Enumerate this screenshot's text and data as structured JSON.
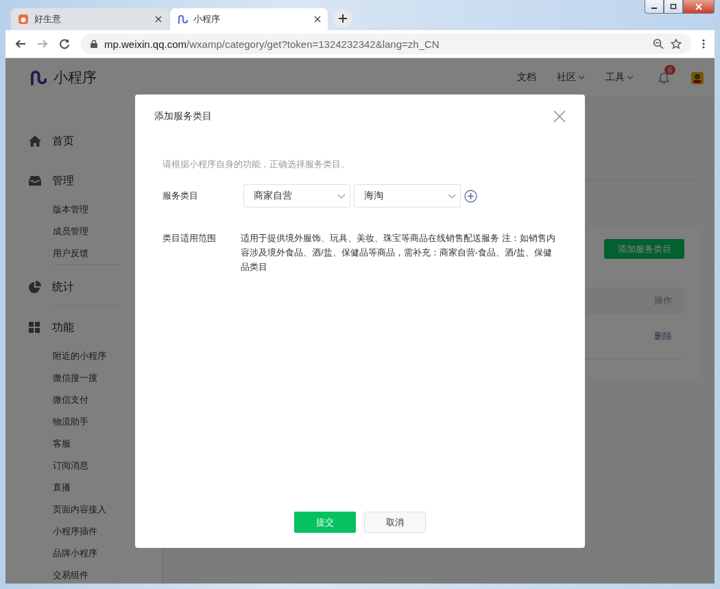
{
  "browser": {
    "tabs": [
      {
        "label": "好生意",
        "selected": false
      },
      {
        "label": "小程序",
        "selected": true
      }
    ],
    "url": {
      "host": "mp.weixin.qq.com",
      "path": "/wxamp/category/get?token=1324232342&lang=zh_CN"
    }
  },
  "header": {
    "logo_text": "小程序",
    "nav": [
      {
        "label": "文档",
        "dropdown": false
      },
      {
        "label": "社区",
        "dropdown": true
      },
      {
        "label": "工具",
        "dropdown": true
      }
    ],
    "notification_count": "6"
  },
  "sidebar": {
    "sections": [
      {
        "label": "首页"
      },
      {
        "label": "管理",
        "children": [
          {
            "label": "版本管理"
          },
          {
            "label": "成员管理"
          },
          {
            "label": "用户反馈"
          }
        ]
      },
      {
        "label": "统计"
      },
      {
        "label": "功能",
        "children": [
          {
            "label": "附近的小程序"
          },
          {
            "label": "微信搜一搜"
          },
          {
            "label": "微信支付"
          },
          {
            "label": "物流助手"
          },
          {
            "label": "客服"
          },
          {
            "label": "订阅消息"
          },
          {
            "label": "直播"
          },
          {
            "label": "页面内容接入"
          },
          {
            "label": "小程序插件"
          },
          {
            "label": "品牌小程序"
          },
          {
            "label": "交易组件"
          }
        ]
      }
    ]
  },
  "content": {
    "add_button": "添加服务类目",
    "table": {
      "columns": [
        "操作"
      ],
      "rows": [
        {
          "action": "删除"
        }
      ]
    }
  },
  "dialog": {
    "title": "添加服务类目",
    "hint": "请根据小程序自身的功能，正确选择服务类目。",
    "category": {
      "label": "服务类目",
      "selects": [
        {
          "value": "商家自营"
        },
        {
          "value": "海淘"
        }
      ]
    },
    "scope": {
      "label": "类目适用范围",
      "text": "适用于提供境外服饰、玩具、美妆、珠宝等商品在线销售配送服务 注：如销售内容涉及境外食品、酒/盐、保健品等商品，需补充：商家自营-食品、酒/盐、保健品类目"
    },
    "buttons": [
      {
        "label": "提交",
        "kind": "primary"
      },
      {
        "label": "取消",
        "kind": "default"
      }
    ]
  }
}
